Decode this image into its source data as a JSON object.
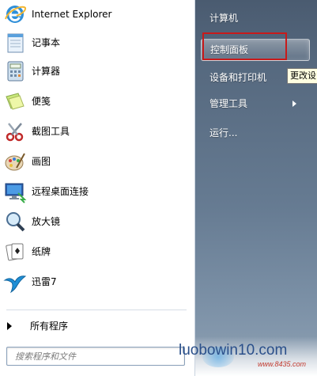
{
  "left_programs": [
    {
      "label": "Internet Explorer",
      "icon": "internet-explorer-icon"
    },
    {
      "label": "记事本",
      "icon": "notepad-icon"
    },
    {
      "label": "计算器",
      "icon": "calculator-icon"
    },
    {
      "label": "便笺",
      "icon": "sticky-notes-icon"
    },
    {
      "label": "截图工具",
      "icon": "snipping-tool-icon"
    },
    {
      "label": "画图",
      "icon": "paint-icon"
    },
    {
      "label": "远程桌面连接",
      "icon": "remote-desktop-icon"
    },
    {
      "label": "放大镜",
      "icon": "magnifier-icon"
    },
    {
      "label": "纸牌",
      "icon": "solitaire-icon"
    },
    {
      "label": "迅雷7",
      "icon": "thunder-icon"
    }
  ],
  "all_programs_label": "所有程序",
  "search": {
    "placeholder": "搜索程序和文件"
  },
  "right_items": [
    {
      "label": "计算机"
    },
    {
      "label": "控制面板"
    },
    {
      "label": "设备和打印机"
    },
    {
      "label": "管理工具"
    },
    {
      "label": "运行..."
    }
  ],
  "tooltip": "更改设",
  "watermark": {
    "brand": "luobowin10.com",
    "url": "www.8435.com"
  }
}
